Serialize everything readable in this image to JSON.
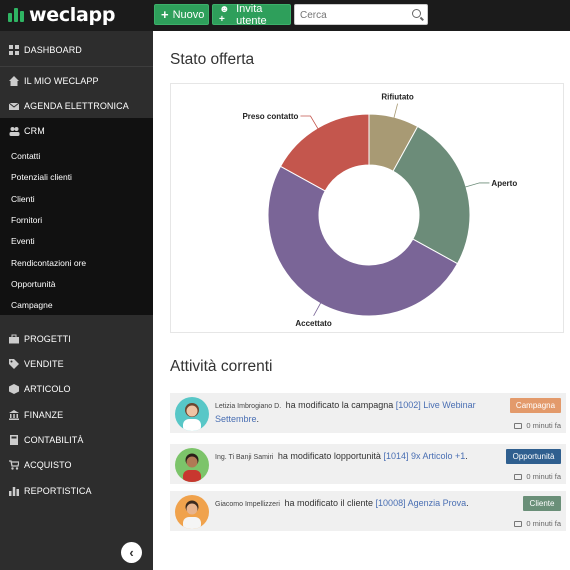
{
  "app": {
    "logo_text": "weclapp",
    "brand_green": "#2fb563"
  },
  "topbar": {
    "new_button": "Nuovo",
    "invite_button": "Invita utente",
    "search_placeholder": "Cerca",
    "search_icon": "search-icon"
  },
  "sidebar": {
    "dashboard": "DASHBOARD",
    "il_mio": "IL MIO WECLAPP",
    "agenda": "AGENDA ELETTRONICA",
    "crm": "CRM",
    "crm_items": [
      "Contatti",
      "Potenziali clienti",
      "Clienti",
      "Fornitori",
      "Eventi",
      "Rendicontazioni ore",
      "Opportunità",
      "Campagne"
    ],
    "progetti": "PROGETTI",
    "vendite": "VENDITE",
    "articolo": "ARTICOLO",
    "finanze": "FINANZE",
    "contabilita": "CONTABILITÀ",
    "acquisto": "ACQUISTO",
    "reportistica": "REPORTISTICA",
    "collapse_icon": "chevron-left-icon"
  },
  "main": {
    "chart_title": "Stato offerta",
    "activity_title": "Attività correnti",
    "activities": [
      {
        "user": "Letizia Imbrogiano D.",
        "action": "ha modificato la campagna",
        "link": "[1002] Live Webinar Settembre",
        "tail": ".",
        "badge": "Campagna",
        "badge_color": "#e39a6b",
        "time": "0 minuti fa"
      },
      {
        "user": "Ing. Ti Banji Samiri",
        "action": "ha modificato lopportunità",
        "link": "[1014] 9x Articolo +1",
        "tail": ".",
        "badge": "Opportunità",
        "badge_color": "#2f5f8f",
        "time": "0 minuti fa"
      },
      {
        "user": "Giacomo Impellizzeri",
        "action": "ha modificato il cliente",
        "link": "[10008] Agenzia Prova",
        "tail": ".",
        "badge": "Cliente",
        "badge_color": "#6a8f78",
        "time": "0 minuti fa"
      }
    ]
  },
  "chart_data": {
    "type": "pie",
    "donut": true,
    "categories": [
      "Rifiutato",
      "Aperto",
      "Accettato",
      "Preso contatto"
    ],
    "values": [
      8,
      25,
      50,
      17
    ],
    "colors": [
      "#a89a74",
      "#6c8c79",
      "#7a6597",
      "#c4564d"
    ],
    "title": "Stato offerta"
  }
}
